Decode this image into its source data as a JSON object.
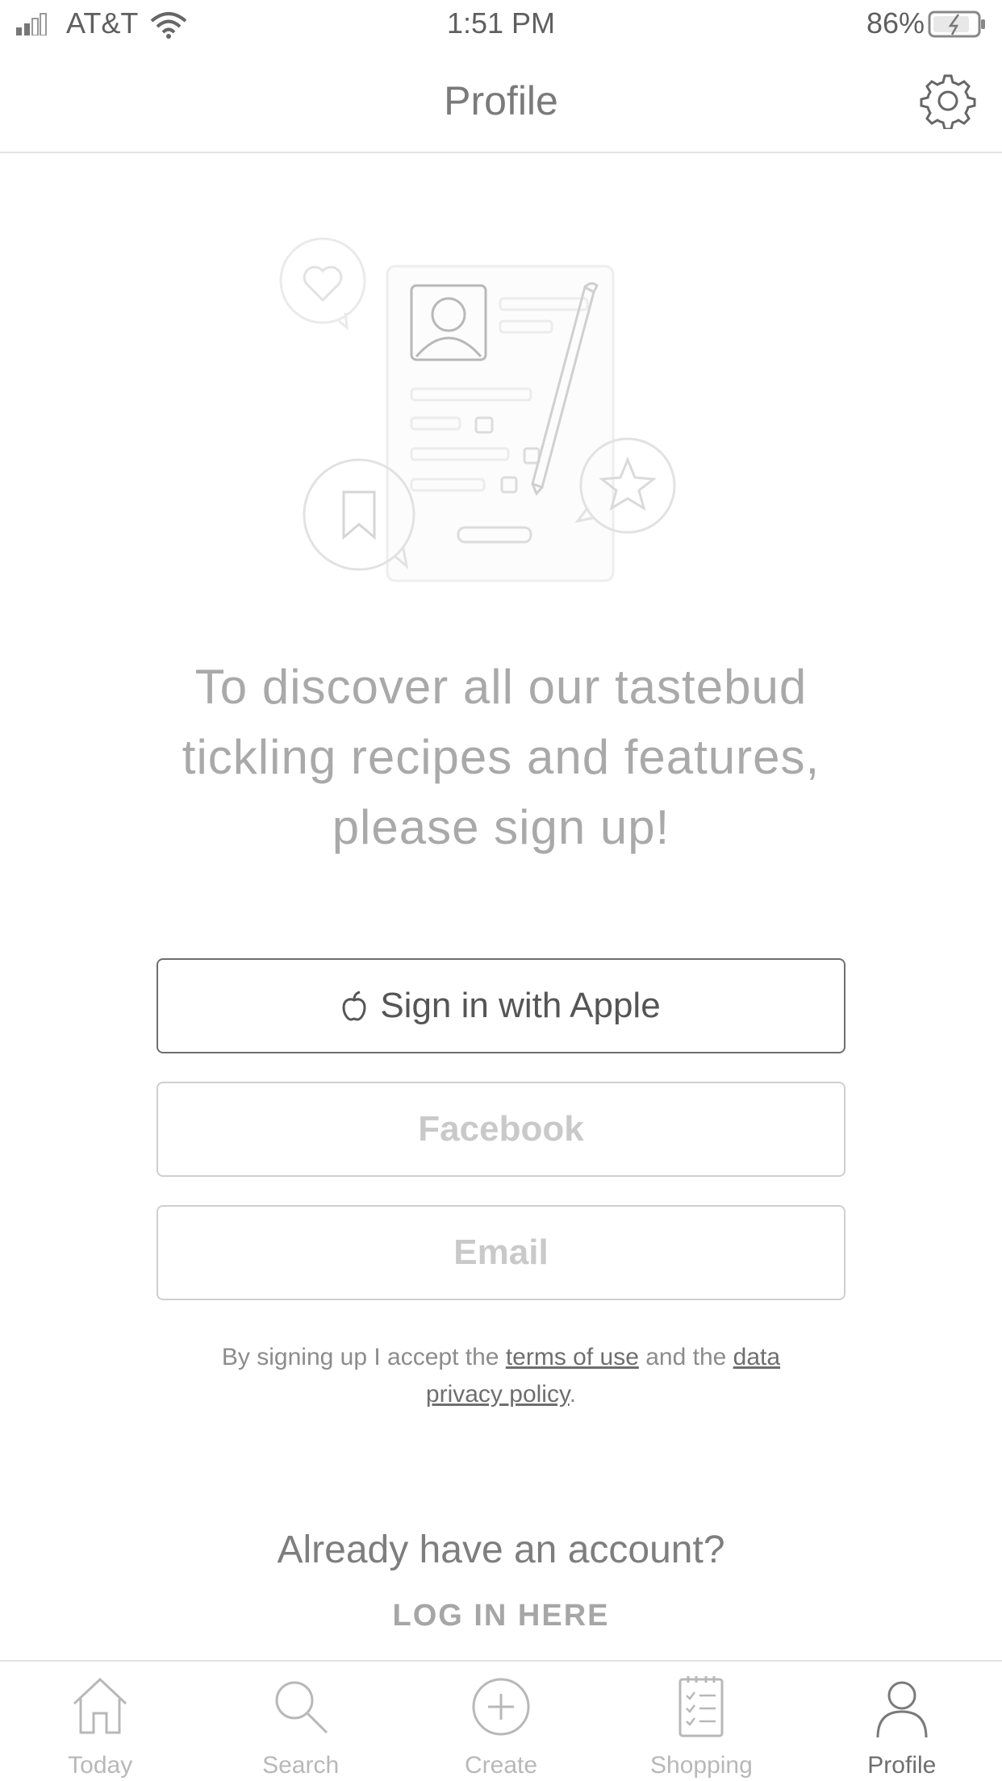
{
  "status_bar": {
    "carrier": "AT&T",
    "time": "1:51 PM",
    "battery_percent": "86%"
  },
  "nav": {
    "title": "Profile",
    "settings_icon": "gear-icon"
  },
  "headline": {
    "line1": "To discover all our tastebud",
    "line2": "tickling recipes and features,",
    "line3": "please sign up!"
  },
  "buttons": {
    "apple_label": "Sign in with Apple",
    "facebook_label": "Facebook",
    "email_label": "Email"
  },
  "legal": {
    "prefix": "By signing up I accept the",
    "terms_link": "terms of use",
    "middle": "and the",
    "privacy_link": "data privacy policy",
    "suffix": "."
  },
  "login": {
    "question": "Already have an account?",
    "link": "LOG IN HERE"
  },
  "tabs": [
    {
      "label": "Today",
      "icon": "home-icon",
      "active": false
    },
    {
      "label": "Search",
      "icon": "search-icon",
      "active": false
    },
    {
      "label": "Create",
      "icon": "plus-circle-icon",
      "active": false
    },
    {
      "label": "Shopping",
      "icon": "checklist-icon",
      "active": false
    },
    {
      "label": "Profile",
      "icon": "person-icon",
      "active": true
    }
  ]
}
